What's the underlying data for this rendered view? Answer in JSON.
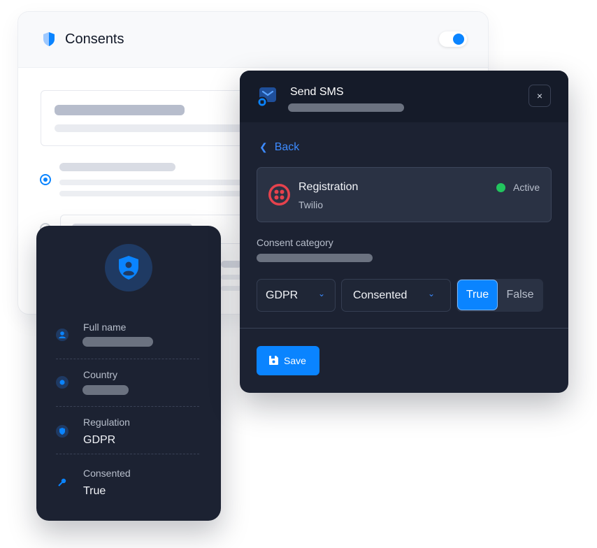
{
  "consents": {
    "title": "Consents",
    "toggle_on": true
  },
  "profile": {
    "fields": [
      {
        "label": "Full name",
        "value": ""
      },
      {
        "label": "Country",
        "value": ""
      },
      {
        "label": "Regulation",
        "value": "GDPR"
      },
      {
        "label": "Consented",
        "value": "True"
      }
    ]
  },
  "sms": {
    "title": "Send SMS",
    "close_label": "×",
    "back_label": "Back",
    "integration": {
      "name": "Registration",
      "provider": "Twilio",
      "status": "Active"
    },
    "category_label": "Consent category",
    "regulation_select": "GDPR",
    "consent_select": "Consented",
    "segment": {
      "true_label": "True",
      "false_label": "False",
      "selected": "True"
    },
    "save_label": "Save"
  },
  "colors": {
    "accent": "#0a84ff",
    "dark_panel": "#1c2232",
    "active_status": "#22c55e",
    "twilio_red": "#e5424d"
  }
}
